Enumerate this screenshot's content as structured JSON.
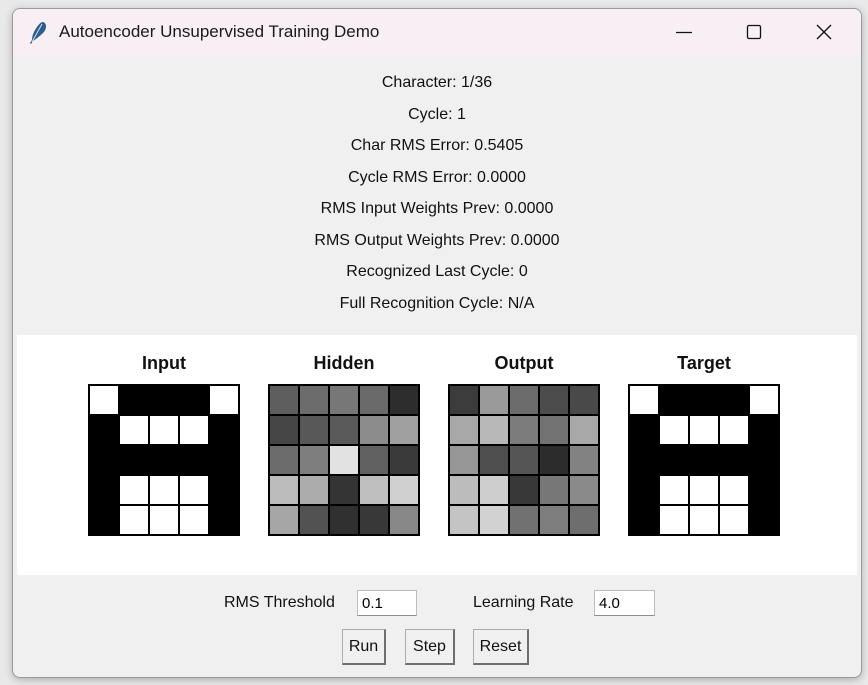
{
  "window": {
    "title": "Autoencoder Unsupervised Training Demo",
    "icon": "feather-icon",
    "controls": [
      "minimize-icon",
      "maximize-icon",
      "close-icon"
    ]
  },
  "stats": [
    "Character: 1/36",
    "Cycle: 1",
    "Char RMS Error: 0.5405",
    "Cycle RMS Error: 0.0000",
    "RMS Input Weights Prev: 0.0000",
    "RMS Output Weights Prev: 0.0000",
    "Recognized Last Cycle: 0",
    "Full Recognition Cycle: N/A"
  ],
  "grids": [
    {
      "title": "Input",
      "cells": [
        "#ffffff",
        "#000000",
        "#000000",
        "#000000",
        "#ffffff",
        "#000000",
        "#ffffff",
        "#ffffff",
        "#ffffff",
        "#000000",
        "#000000",
        "#000000",
        "#000000",
        "#000000",
        "#000000",
        "#000000",
        "#ffffff",
        "#ffffff",
        "#ffffff",
        "#000000",
        "#000000",
        "#ffffff",
        "#ffffff",
        "#ffffff",
        "#000000"
      ]
    },
    {
      "title": "Hidden",
      "cells": [
        "#5e5e5e",
        "#6c6c6c",
        "#777777",
        "#6a6a6a",
        "#2d2d2d",
        "#454545",
        "#585858",
        "#5a5a5a",
        "#8c8c8c",
        "#a0a0a0",
        "#6c6c6c",
        "#7e7e7e",
        "#e2e2e2",
        "#606060",
        "#3a3a3a",
        "#bcbcbc",
        "#acacac",
        "#343434",
        "#bfbfbf",
        "#d0d0d0",
        "#a6a6a6",
        "#525252",
        "#303030",
        "#383838",
        "#888888"
      ]
    },
    {
      "title": "Output",
      "cells": [
        "#3c3c3c",
        "#9a9a9a",
        "#6c6c6c",
        "#4c4c4c",
        "#494949",
        "#a8a8a8",
        "#b8b8b8",
        "#7c7c7c",
        "#727272",
        "#a8a8a8",
        "#969696",
        "#4e4e4e",
        "#555555",
        "#2c2c2c",
        "#828282",
        "#bcbcbc",
        "#cecece",
        "#383838",
        "#777777",
        "#8a8a8a",
        "#c4c4c4",
        "#d2d2d2",
        "#717171",
        "#7e7e7e",
        "#6e6e6e"
      ]
    },
    {
      "title": "Target",
      "cells": [
        "#ffffff",
        "#000000",
        "#000000",
        "#000000",
        "#ffffff",
        "#000000",
        "#ffffff",
        "#ffffff",
        "#ffffff",
        "#000000",
        "#000000",
        "#000000",
        "#000000",
        "#000000",
        "#000000",
        "#000000",
        "#ffffff",
        "#ffffff",
        "#ffffff",
        "#000000",
        "#000000",
        "#ffffff",
        "#ffffff",
        "#ffffff",
        "#000000"
      ]
    }
  ],
  "controls": {
    "rms_threshold_label": "RMS Threshold",
    "rms_threshold_value": "0.1",
    "learning_rate_label": "Learning Rate",
    "learning_rate_value": "4.0",
    "run_label": "Run",
    "step_label": "Step",
    "reset_label": "Reset"
  }
}
